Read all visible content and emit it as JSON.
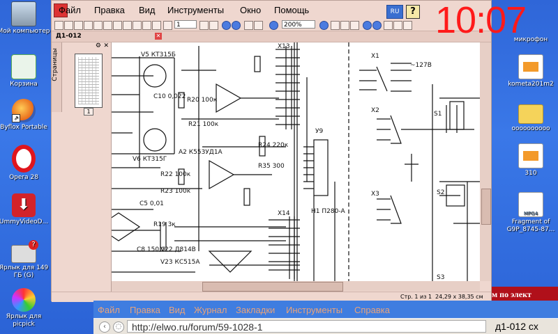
{
  "desktop": {
    "icons_left": [
      {
        "label": "Мой компьютер",
        "icon": "computer-icon"
      },
      {
        "label": "Корзина",
        "icon": "recycle-bin-icon"
      },
      {
        "label": "Byflox Portable",
        "icon": "firefox-icon"
      },
      {
        "label": "Opera 28",
        "icon": "opera-icon"
      },
      {
        "label": "UmmyVideoD...",
        "icon": "download-icon"
      },
      {
        "label": "Ярлык для 149 ГБ (G)",
        "icon": "drive-icon"
      },
      {
        "label": "Ярлык для picpick",
        "icon": "palette-icon"
      }
    ],
    "icons_right": [
      {
        "label": "микрофон",
        "icon": "microphone-icon"
      },
      {
        "label": "kometa201m2",
        "icon": "image-file-icon"
      },
      {
        "label": "оооооооооо",
        "icon": "folder-icon"
      },
      {
        "label": "310",
        "icon": "image-file-icon"
      },
      {
        "label": "Fragment of G9P_8745-87...",
        "icon": "mpg4-file-icon"
      }
    ]
  },
  "clock": "10:07",
  "viewer": {
    "menu": [
      "Файл",
      "Правка",
      "Вид",
      "Инструменты",
      "Окно",
      "Помощь"
    ],
    "lang": "RU",
    "help": "?",
    "page_input": "1",
    "zoom_value": "200%",
    "tab_title": "Д1-012",
    "sidebar_tab": "Страницы",
    "thumb_page_number": "1",
    "status_page": "Стр. 1 из 1",
    "status_size": "24,29 x 38,35 см"
  },
  "schematic_labels": [
    "V5 КТ315Б",
    "C10 0,022",
    "R20 100к",
    "R21 100к",
    "A2 К553УД1А",
    "V6 КТ315Г",
    "R22 100к",
    "R23 100к",
    "C5 0,01",
    "R19 3к",
    "C8 150,0",
    "V22 Д814В",
    "V23 КС515А",
    "X13",
    "X14",
    "X1",
    "X2",
    "X3",
    "R24 220к",
    "R35 300",
    "Н1 П280-А",
    "~127В",
    "S1",
    "S2",
    "S3",
    "У9"
  ],
  "banner_text": "м по элект",
  "browser": {
    "menu": [
      "Файл",
      "Правка",
      "Вид",
      "Журнал",
      "Закладки",
      "Инструменты",
      "Справка"
    ],
    "url": "http://elwo.ru/forum/59-1028-1",
    "tab_title": "д1-012 сх"
  }
}
